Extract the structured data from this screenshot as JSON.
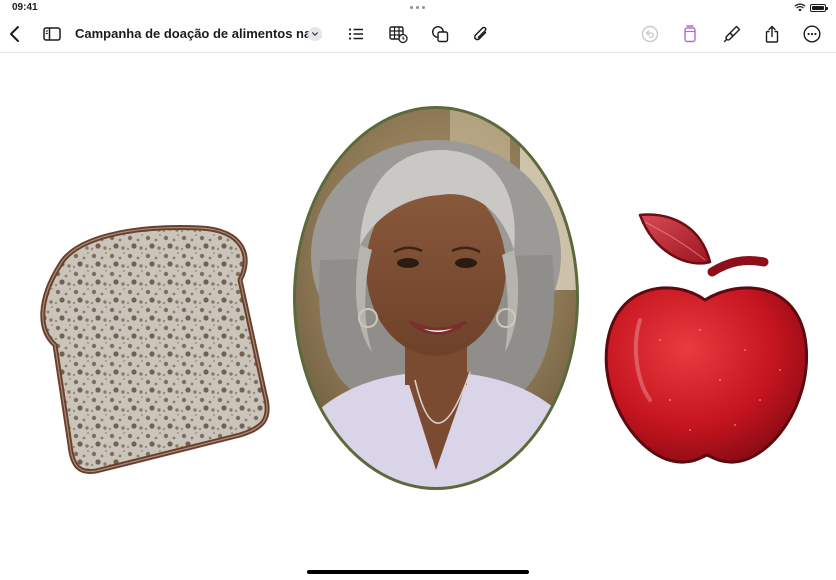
{
  "status": {
    "time": "09:41"
  },
  "toolbar": {
    "title": "Campanha de doação de alimentos na...",
    "icons": {
      "back": "chevron-left-icon",
      "sidebar": "sidebar-icon",
      "title_menu": "chevron-down-icon",
      "list": "list-icon",
      "table": "table-clock-icon",
      "shapes": "shapes-icon",
      "attach": "paperclip-icon",
      "undo": "undo-icon",
      "eraser": "eraser-icon",
      "brush": "paintbrush-icon",
      "share": "share-icon",
      "more": "ellipsis-circle-icon"
    }
  },
  "canvas": {
    "items": [
      "bread-slice-sticker",
      "woman-portrait-oval",
      "apple-sticker"
    ]
  },
  "colors": {
    "accent_purple": "#b46ad8",
    "frame_green": "#5b6a3a",
    "bread_border": "#6a3f2a",
    "apple_red": "#c4141f"
  }
}
